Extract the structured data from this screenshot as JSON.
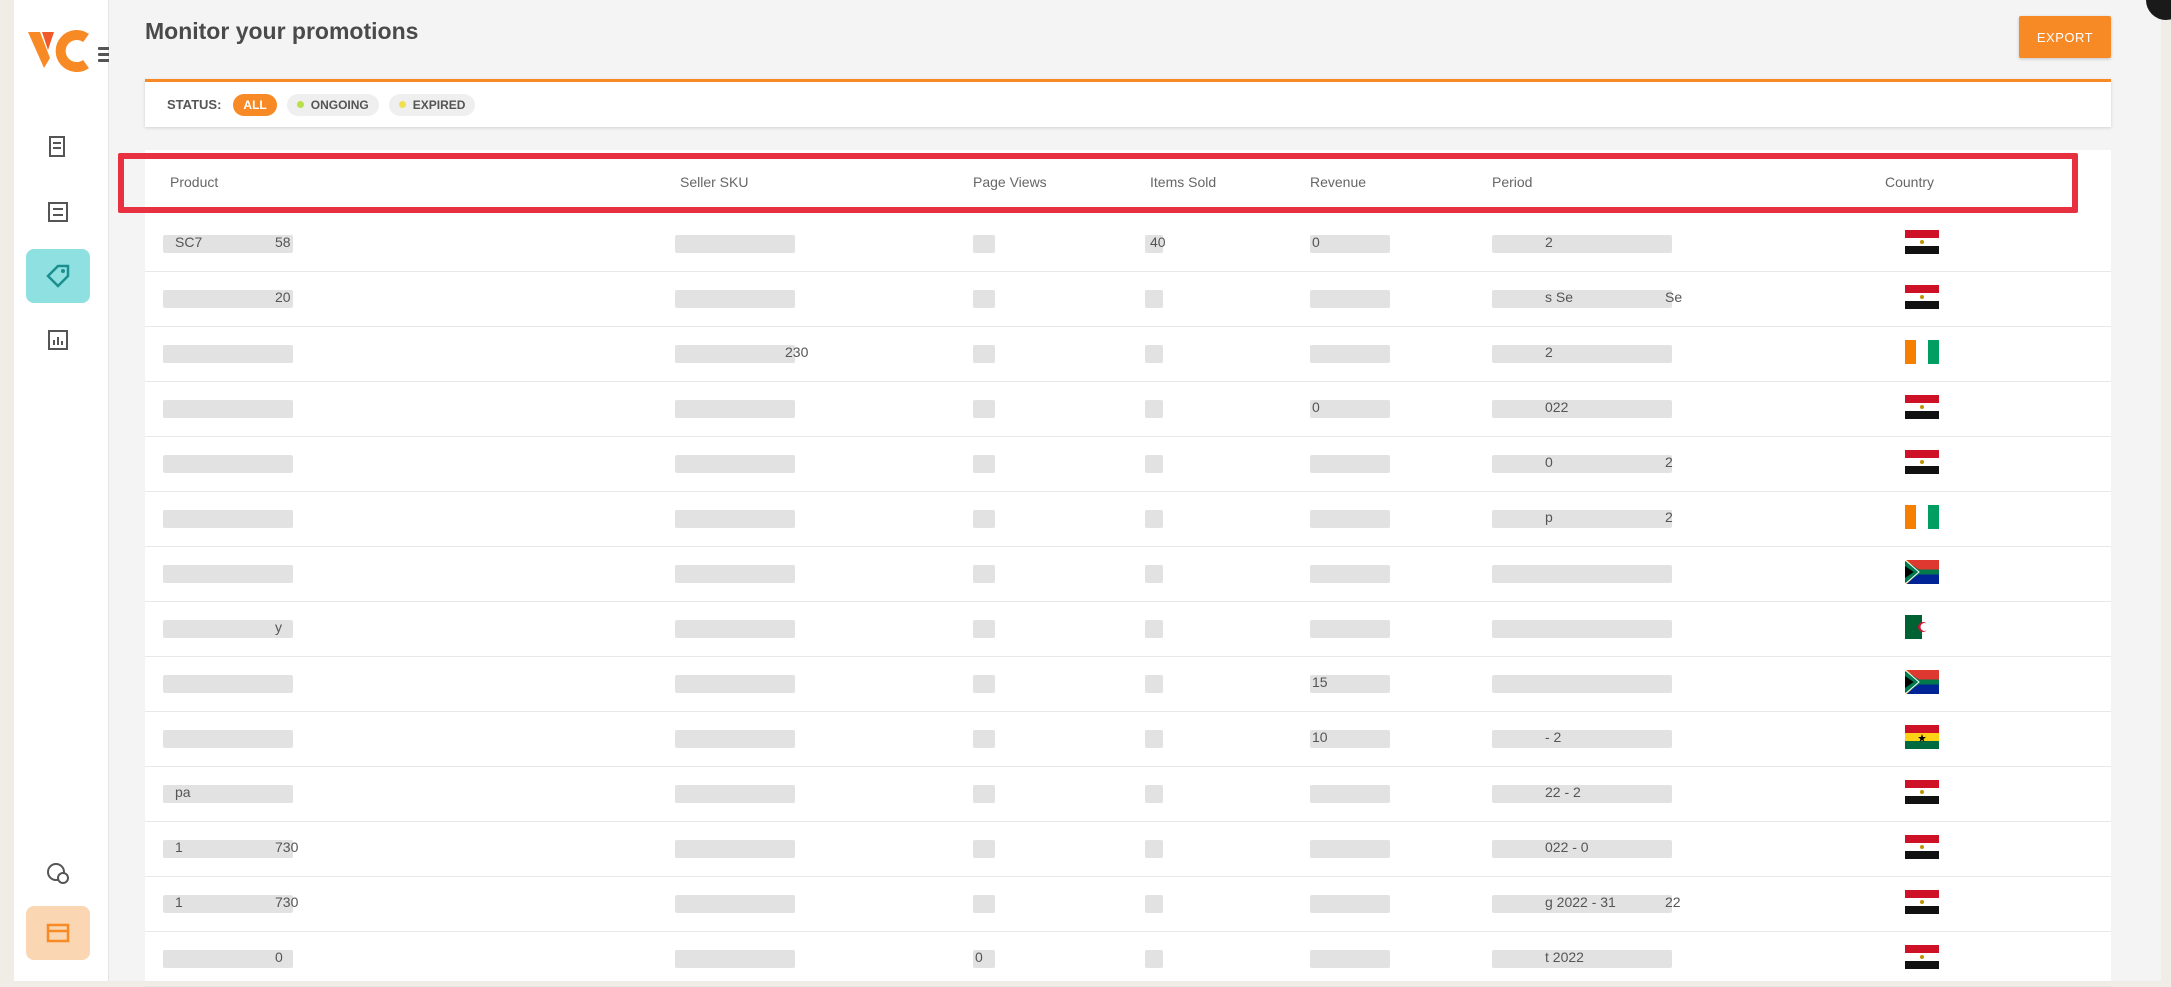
{
  "page": {
    "title": "Monitor your promotions",
    "export_label": "EXPORT"
  },
  "filters": {
    "status_label": "STATUS:",
    "chips": [
      {
        "label": "ALL",
        "active": true
      },
      {
        "label": "ONGOING",
        "dot_color": "#b8e04a"
      },
      {
        "label": "EXPIRED",
        "dot_color": "#f0e050"
      }
    ]
  },
  "table": {
    "headers": [
      "Product",
      "Seller SKU",
      "Page Views",
      "Items Sold",
      "Revenue",
      "Period",
      "Country"
    ],
    "rows": [
      {
        "product": "SC7",
        "product_tail": "58",
        "sku": "",
        "views": "",
        "sold": "40",
        "revenue": "0",
        "period": "2",
        "flag": "egypt"
      },
      {
        "product": "",
        "product_tail": "20",
        "sku": "",
        "views": "",
        "sold": "",
        "revenue": "",
        "period": "s Se",
        "period_tail": "Se",
        "flag": "egypt"
      },
      {
        "product": "",
        "product_tail": "",
        "sku": "230",
        "views": "",
        "sold": "",
        "revenue": "",
        "period": "2",
        "flag": "cote-divoire"
      },
      {
        "product": "",
        "product_tail": "",
        "sku": "",
        "views": "",
        "sold": "",
        "revenue": "0",
        "period": "022",
        "flag": "egypt"
      },
      {
        "product": "",
        "product_tail": "",
        "sku": "",
        "views": "",
        "sold": "",
        "revenue": "",
        "period": "0",
        "period_tail": "2",
        "flag": "egypt"
      },
      {
        "product": "",
        "product_tail": "",
        "sku": "",
        "views": "",
        "sold": "",
        "revenue": "",
        "period": "p",
        "period_tail": "2",
        "flag": "cote-divoire"
      },
      {
        "product": "",
        "product_tail": "",
        "sku": "",
        "views": "",
        "sold": "",
        "revenue": "",
        "period": "",
        "flag": "south-africa"
      },
      {
        "product": "",
        "product_tail": "y",
        "sku": "",
        "views": "",
        "sold": "",
        "revenue": "",
        "period": "",
        "flag": "algeria"
      },
      {
        "product": "",
        "product_tail": "",
        "sku": "",
        "views": "",
        "sold": "",
        "revenue": "15",
        "period": "",
        "flag": "south-africa"
      },
      {
        "product": "",
        "product_tail": "",
        "sku": "",
        "views": "",
        "sold": "",
        "revenue": "10",
        "period": "- 2",
        "flag": "ghana"
      },
      {
        "product": "pa",
        "product_tail": "",
        "sku": "",
        "views": "",
        "sold": "",
        "revenue": "",
        "period": "22 - 2",
        "flag": "egypt"
      },
      {
        "product": "1",
        "product_tail": "730",
        "sku": "",
        "views": "",
        "sold": "",
        "revenue": "",
        "period": "022 - 0",
        "flag": "egypt"
      },
      {
        "product": "1",
        "product_tail": "730",
        "sku": "",
        "views": "",
        "sold": "",
        "revenue": "",
        "period": "g 2022 - 31",
        "period_tail": "22",
        "flag": "egypt"
      },
      {
        "product": "",
        "product_tail": "0",
        "sku": "",
        "views": "0",
        "sold": "",
        "revenue": "",
        "period": "t 2022",
        "flag": "egypt"
      }
    ]
  },
  "colors": {
    "accent": "#f78a24",
    "highlight": "#e73040",
    "active_nav": "#8fe0e0"
  },
  "sidebar": {
    "icons": [
      "orders-icon",
      "list-icon",
      "promotions-tag-icon",
      "reports-icon",
      "settings-money-icon",
      "store-icon"
    ]
  }
}
